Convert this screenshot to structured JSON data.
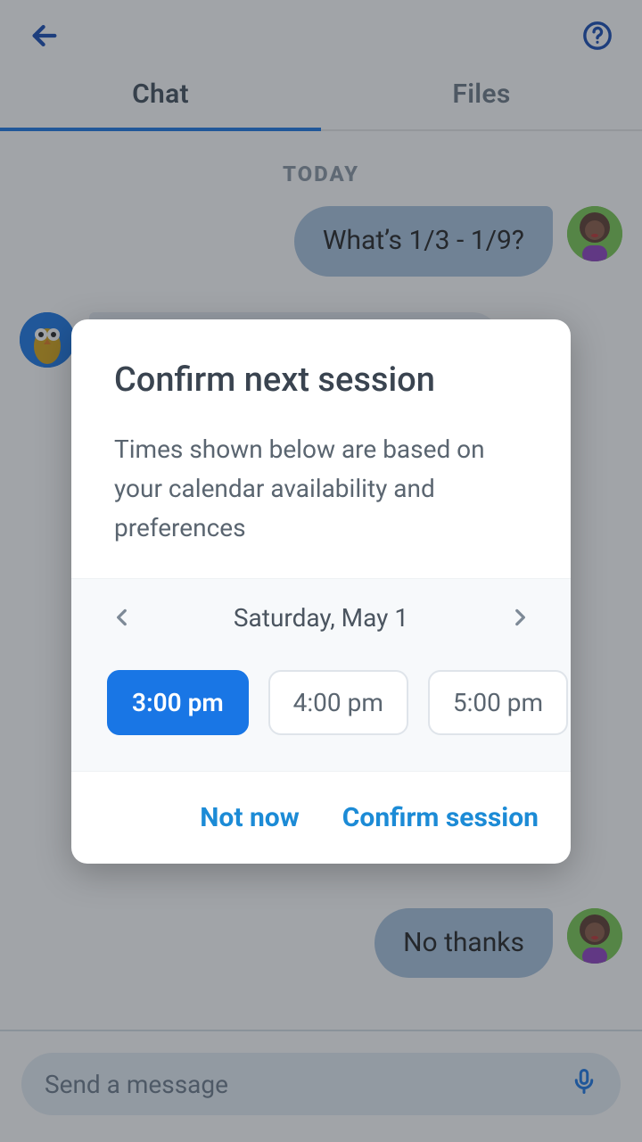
{
  "header": {},
  "tabs": {
    "chat": "Chat",
    "files": "Files",
    "active": "chat"
  },
  "day_label": "TODAY",
  "messages": {
    "m1": "What’s 1/3 - 1/9?",
    "m2": "No thanks"
  },
  "composer": {
    "placeholder": "Send a message"
  },
  "dialog": {
    "title": "Confirm next session",
    "description": "Times shown below are based on your calendar availability and preferences",
    "date": "Saturday, May 1",
    "slots": [
      "3:00 pm",
      "4:00 pm",
      "5:00 pm"
    ],
    "selected_slot": 0,
    "actions": {
      "dismiss": "Not now",
      "confirm": "Confirm session"
    }
  }
}
